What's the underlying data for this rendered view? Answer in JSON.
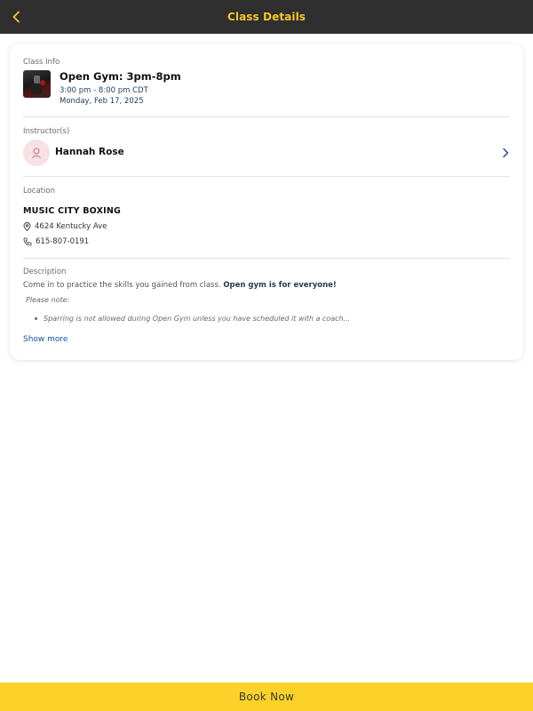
{
  "header": {
    "title": "Class Details",
    "back_icon": "chevron-left-icon"
  },
  "class_info": {
    "section_label": "Class Info",
    "title": "Open Gym: 3pm-8pm",
    "time": "3:00 pm - 8:00 pm CDT",
    "date": "Monday, Feb 17, 2025"
  },
  "instructors": {
    "section_label": "Instructor(s)",
    "name": "Hannah Rose"
  },
  "location": {
    "section_label": "Location",
    "name": "MUSIC CITY BOXING",
    "address": "4624 Kentucky Ave",
    "phone": "615-807-0191"
  },
  "description": {
    "section_label": "Description",
    "text_plain": "Come in to practice the skills you gained from class. ",
    "text_bold": "Open gym is for everyone!",
    "note": "Please note:",
    "bullet": "Sparring is not allowed during Open Gym unless you have scheduled it with a coach...",
    "show_more": "Show more"
  },
  "footer": {
    "book_label": "Book Now"
  },
  "colors": {
    "header_bg": "#2e2f2e",
    "accent_yellow": "#fcd12a",
    "title_yellow": "#f8c62f",
    "link_blue": "#1a4fa0",
    "avatar_pink": "#f7e1e5"
  }
}
